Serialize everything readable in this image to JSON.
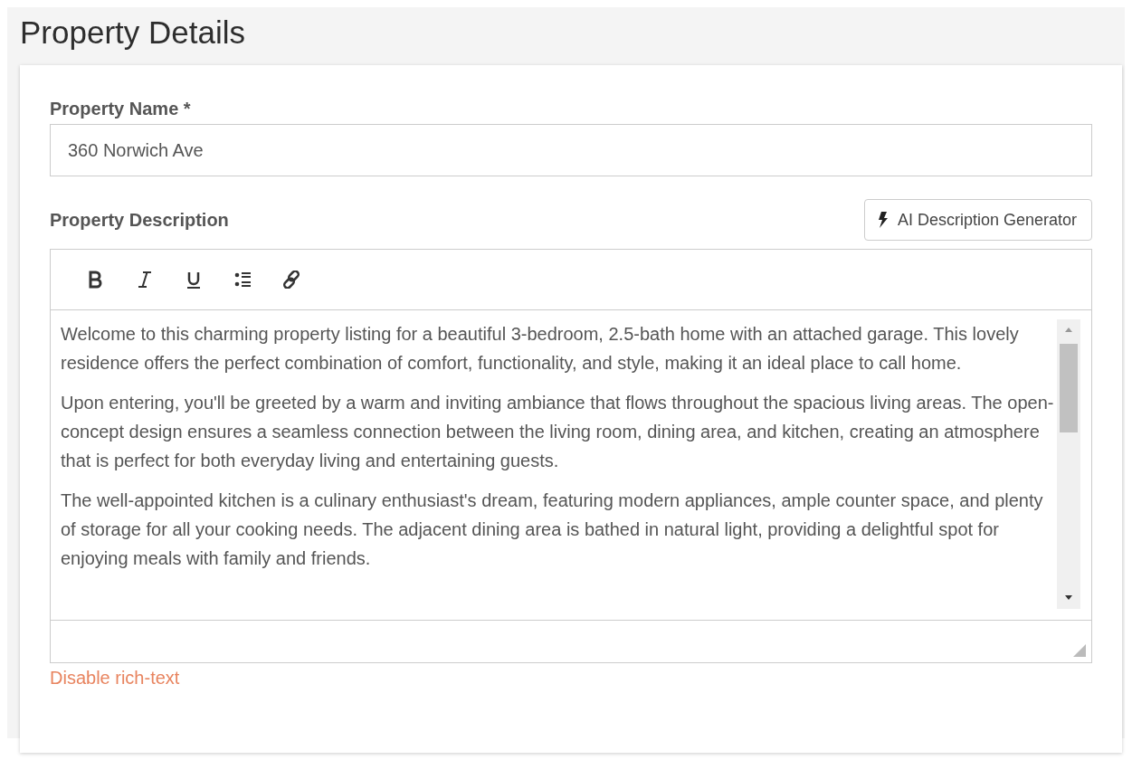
{
  "page_title": "Property Details",
  "name_field": {
    "label": "Property Name *",
    "value": "360 Norwich Ave"
  },
  "description_field": {
    "label": "Property Description",
    "ai_button": "AI Description Generator",
    "toolbar": [
      {
        "kind": "bold"
      },
      {
        "kind": "italic"
      },
      {
        "kind": "underline"
      },
      {
        "kind": "list"
      },
      {
        "kind": "link"
      }
    ],
    "paragraphs": [
      "Welcome to this charming property listing for a beautiful 3-bedroom, 2.5-bath home with an attached garage. This lovely residence offers the perfect combination of comfort, functionality, and style, making it an ideal place to call home.",
      "Upon entering, you'll be greeted by a warm and inviting ambiance that flows throughout the spacious living areas. The open-concept design ensures a seamless connection between the living room, dining area, and kitchen, creating an atmosphere that is perfect for both everyday living and entertaining guests.",
      "The well-appointed kitchen is a culinary enthusiast's dream, featuring modern appliances, ample counter space, and plenty of storage for all your cooking needs. The adjacent dining area is bathed in natural light, providing a delightful spot for enjoying meals with family and friends."
    ]
  },
  "toggle_link": "Disable rich-text"
}
